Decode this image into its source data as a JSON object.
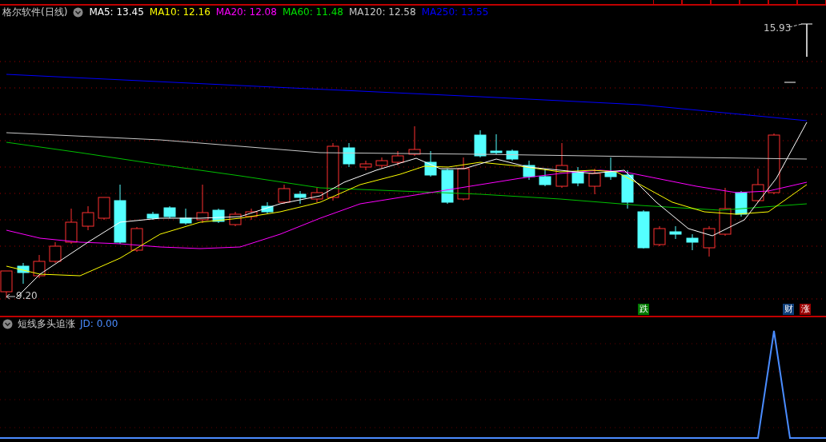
{
  "header": {
    "title": "格尔软件(日线)",
    "indicators": [
      {
        "label": "MA5: 13.45",
        "color": "#ffffff"
      },
      {
        "label": "MA10: 12.16",
        "color": "#ffff00"
      },
      {
        "label": "MA20: 12.08",
        "color": "#ff00ff"
      },
      {
        "label": "MA60: 11.48",
        "color": "#00e000"
      },
      {
        "label": "MA120: 12.58",
        "color": "#c8c8c8"
      },
      {
        "label": "MA250: 13.55",
        "color": "#0000ff"
      }
    ]
  },
  "price_chart": {
    "high_label": "15.93",
    "low_label": "9.20",
    "markers": [
      {
        "text": "跌",
        "color": "#007a00"
      },
      {
        "text": "财",
        "color": "#0e3f7a"
      },
      {
        "text": "涨",
        "color": "#9a0000"
      }
    ]
  },
  "indicator_panel": {
    "title": "短线多头追涨",
    "value": "JD: 0.00"
  }
}
